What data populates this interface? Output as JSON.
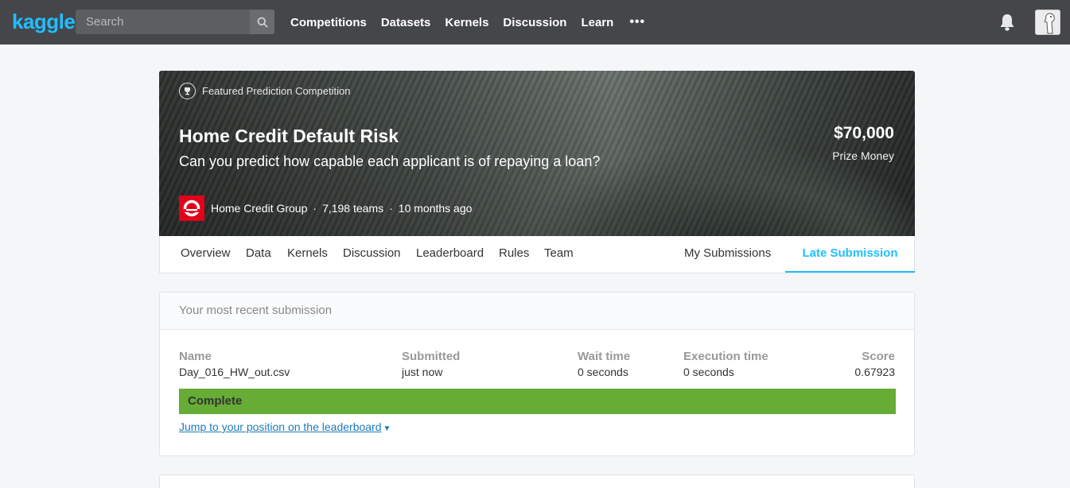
{
  "nav": {
    "logo": "kaggle",
    "search_placeholder": "Search",
    "links": [
      "Competitions",
      "Datasets",
      "Kernels",
      "Discussion",
      "Learn"
    ],
    "more_label": "•••"
  },
  "hero": {
    "featured_label": "Featured Prediction Competition",
    "title": "Home Credit Default Risk",
    "subtitle": "Can you predict how capable each applicant is of repaying a loan?",
    "prize_amount": "$70,000",
    "prize_label": "Prize Money",
    "host": "Home Credit Group",
    "teams": "7,198 teams",
    "age": "10 months ago",
    "separator": "·",
    "brand_color": "#e4001b"
  },
  "tabs": {
    "left": [
      "Overview",
      "Data",
      "Kernels",
      "Discussion",
      "Leaderboard",
      "Rules",
      "Team"
    ],
    "my_submissions": "My Submissions",
    "late_submission": "Late Submission"
  },
  "submission": {
    "heading": "Your most recent submission",
    "columns": {
      "name": {
        "label": "Name",
        "value": "Day_016_HW_out.csv"
      },
      "submitted": {
        "label": "Submitted",
        "value": "just now"
      },
      "wait": {
        "label": "Wait time",
        "value": "0 seconds"
      },
      "execution": {
        "label": "Execution time",
        "value": "0 seconds"
      },
      "score": {
        "label": "Score",
        "value": "0.67923"
      }
    },
    "status": "Complete",
    "status_color": "#66ac35",
    "jump_link": "Jump to your position on the leaderboard"
  },
  "colors": {
    "accent": "#20beff",
    "nav_bg": "#45464a"
  }
}
